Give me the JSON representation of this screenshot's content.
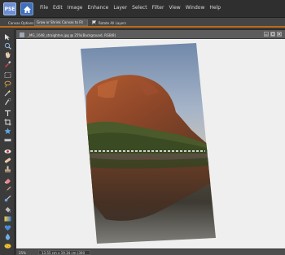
{
  "menubar": {
    "logo_text": "PSE",
    "items": [
      "File",
      "Edit",
      "Image",
      "Enhance",
      "Layer",
      "Select",
      "Filter",
      "View",
      "Window",
      "Help"
    ]
  },
  "options": {
    "label": "Canvas Options:",
    "select_value": "Grow or Shrink Canvas to Fit",
    "rotate_all_layers_label": "Rotate All Layers",
    "rotate_all_layers_checked": true
  },
  "document": {
    "tab_title": "_MG_1648_straighten.jpg @ 25%(Background, RGB/8)",
    "zoom": "25%",
    "doc_size": "13.55 cm x 19.34 cm (300 ppi)"
  },
  "tools": [
    "move-tool",
    "zoom-tool",
    "hand-tool",
    "eyedropper-tool",
    "marquee-tool",
    "lasso-tool",
    "magic-wand-tool",
    "quick-selection-tool",
    "type-tool",
    "crop-tool",
    "cookie-cutter-tool",
    "straighten-tool",
    "red-eye-tool",
    "spot-healing-tool",
    "clone-stamp-tool",
    "eraser-tool",
    "brush-tool",
    "smart-brush-tool",
    "paint-bucket-tool",
    "gradient-tool",
    "shape-tool",
    "blur-tool",
    "sponge-tool",
    "color-swatches"
  ],
  "colors": {
    "accent": "#c06a1a",
    "sky": "#a9b3c4",
    "rock": "#8a4a2a",
    "water": "#3d3a33"
  }
}
